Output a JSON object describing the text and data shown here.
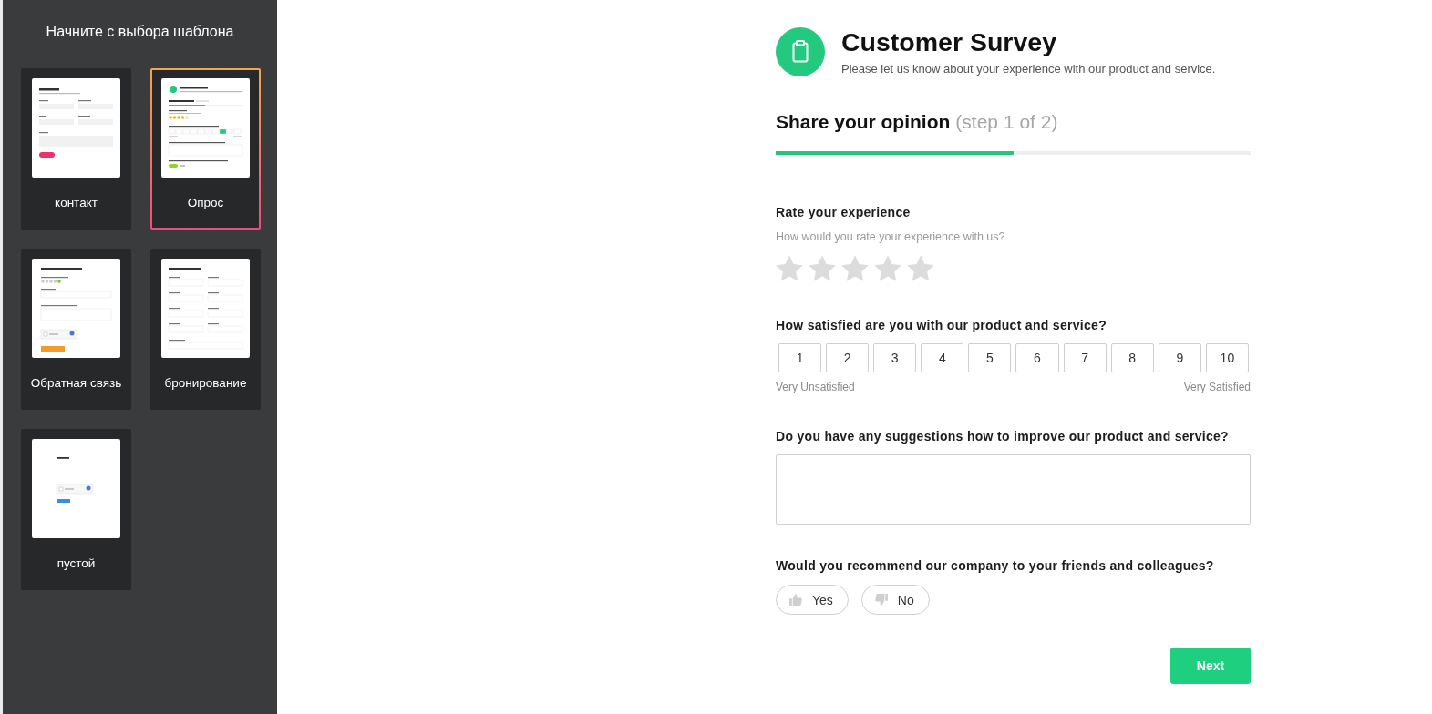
{
  "sidebar": {
    "title": "Начните с выбора шаблона",
    "templates": [
      {
        "label": "контакт",
        "kind": "contact",
        "selected": false
      },
      {
        "label": "Опрос",
        "kind": "survey",
        "selected": true
      },
      {
        "label": "Обратная связь",
        "kind": "feedback",
        "selected": false
      },
      {
        "label": "бронирование",
        "kind": "booking",
        "selected": false
      },
      {
        "label": "пустой",
        "kind": "blank",
        "selected": false
      }
    ]
  },
  "form": {
    "title": "Customer Survey",
    "subtitle": "Please let us know about your experience with our product and service.",
    "step": {
      "title": "Share your opinion",
      "counter": "(step 1 of 2)",
      "level": 0.5
    },
    "questions": [
      {
        "kind": "rating",
        "label": "Rate your experience",
        "hint": "How would you rate your experience with us?",
        "stars": 0
      },
      {
        "kind": "scale",
        "label": "How satisfied are you with our product and service?",
        "options": [
          {
            "label": "1",
            "selected": false
          },
          {
            "label": "2",
            "selected": false
          },
          {
            "label": "3",
            "selected": false
          },
          {
            "label": "4",
            "selected": false
          },
          {
            "label": "5",
            "selected": false
          },
          {
            "label": "6",
            "selected": false
          },
          {
            "label": "7",
            "selected": false
          },
          {
            "label": "8",
            "selected": false
          },
          {
            "label": "9",
            "selected": false
          },
          {
            "label": "10",
            "selected": false
          }
        ],
        "min_label": "Very Unsatisfied",
        "max_label": "Very Satisfied"
      },
      {
        "kind": "text",
        "label": "Do you have any suggestions how to improve our product and service?"
      },
      {
        "kind": "choice",
        "label": "Would you recommend our company to your friends and colleagues?",
        "options": [
          {
            "label": "Yes",
            "kind": "yes",
            "selected": false
          },
          {
            "label": "No",
            "kind": "no",
            "selected": false
          }
        ]
      }
    ],
    "next_button": "Next"
  }
}
